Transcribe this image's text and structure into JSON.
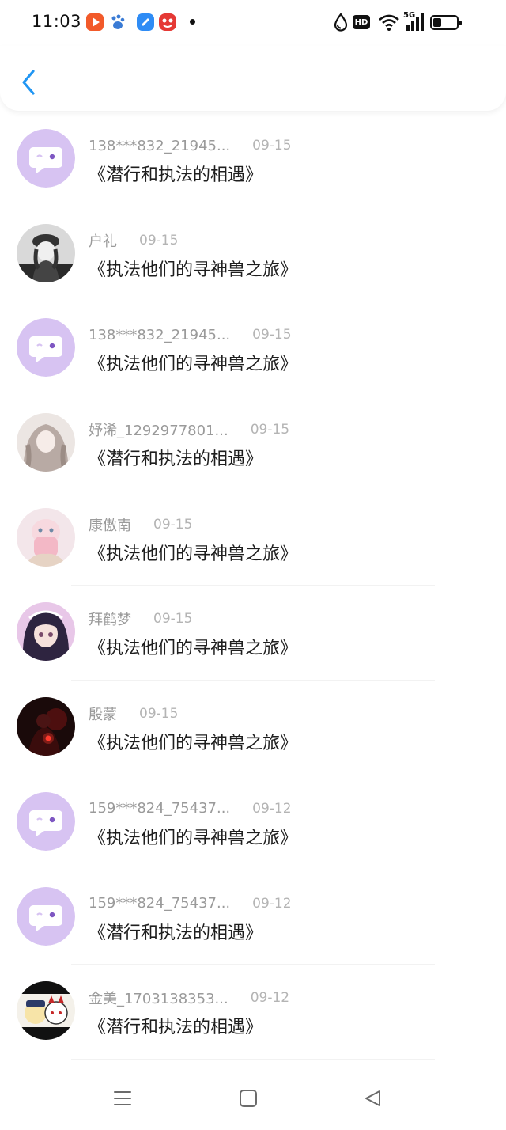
{
  "status_bar": {
    "time": "11:03",
    "network": "5G",
    "hd": "HD",
    "notifications": [
      "video-app-icon",
      "paw-app-icon",
      "blue-app-icon",
      "red-app-icon"
    ]
  },
  "header": {
    "back_icon": "chevron-left-icon"
  },
  "records": [
    {
      "user": "138***832_21945...",
      "date": "09-15",
      "title": "《潜行和执法的相遇》",
      "avatar": "default-chat-bubble"
    },
    {
      "user": "户礼",
      "date": "09-15",
      "title": "《执法他们的寻神兽之旅》",
      "avatar": "photo-grayscale-girl"
    },
    {
      "user": "138***832_21945...",
      "date": "09-15",
      "title": "《执法他们的寻神兽之旅》",
      "avatar": "default-chat-bubble"
    },
    {
      "user": "妤浠_1292977801...",
      "date": "09-15",
      "title": "《潜行和执法的相遇》",
      "avatar": "photo-light-portrait"
    },
    {
      "user": "康傲南",
      "date": "09-15",
      "title": "《执法他们的寻神兽之旅》",
      "avatar": "photo-pink-anime"
    },
    {
      "user": "拜鹤梦",
      "date": "09-15",
      "title": "《执法他们的寻神兽之旅》",
      "avatar": "photo-anime-girl"
    },
    {
      "user": "殷蒙",
      "date": "09-15",
      "title": "《执法他们的寻神兽之旅》",
      "avatar": "photo-dark-red"
    },
    {
      "user": "159***824_75437...",
      "date": "09-12",
      "title": "《执法他们的寻神兽之旅》",
      "avatar": "default-chat-bubble"
    },
    {
      "user": "159***824_75437...",
      "date": "09-12",
      "title": "《潜行和执法的相遇》",
      "avatar": "default-chat-bubble"
    },
    {
      "user": "金美_1703138353...",
      "date": "09-12",
      "title": "《潜行和执法的相遇》",
      "avatar": "photo-cartoon-pair"
    }
  ],
  "nav_bar": {
    "menu_icon": "menu-icon",
    "home_icon": "home-square-icon",
    "back_icon": "back-triangle-icon"
  },
  "colors": {
    "accent": "#2196f3",
    "avatar_default_bg": "#d7c3f2",
    "name": "#9a9a9a",
    "date": "#b4b4b4",
    "title": "#1e1e1e"
  }
}
